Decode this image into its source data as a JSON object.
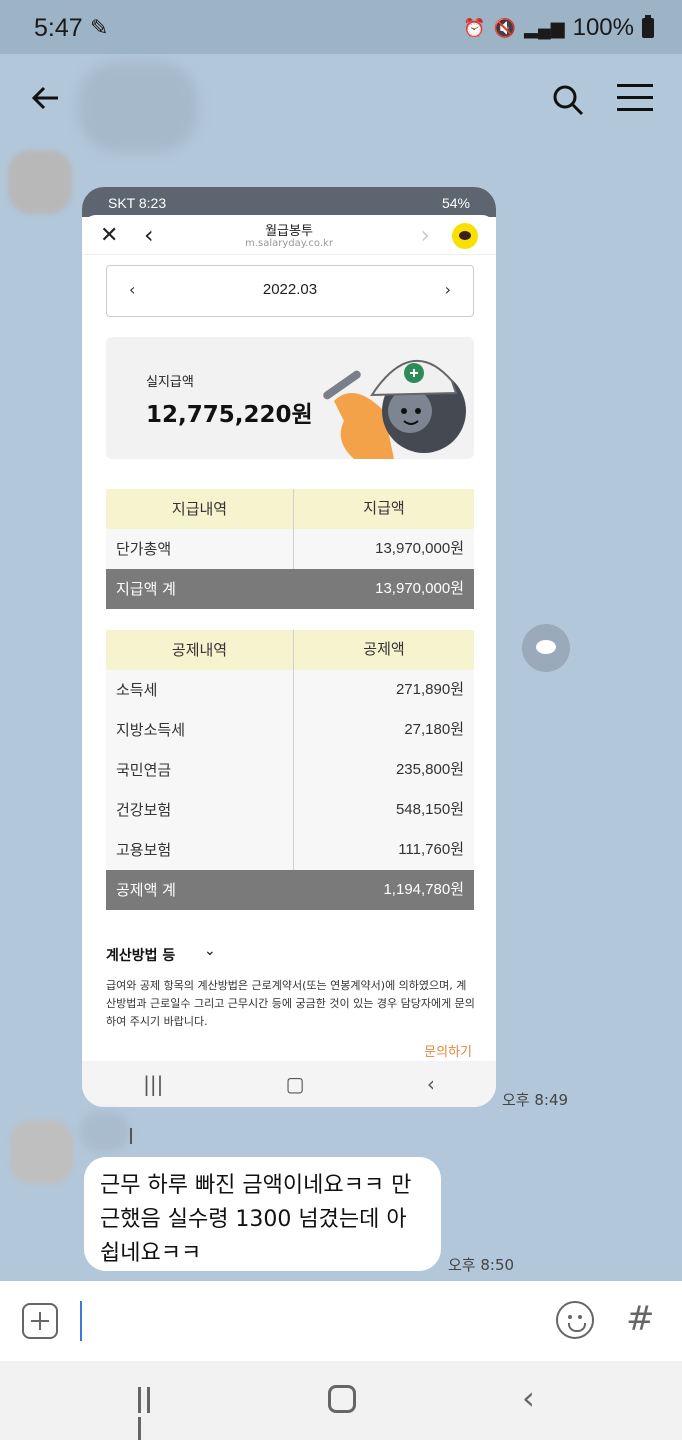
{
  "status_bar": {
    "time": "5:47",
    "battery": "100%"
  },
  "shot": {
    "status": {
      "left": "SKT 8:23",
      "right": "54%"
    },
    "browser": {
      "title": "월급봉투",
      "url": "m.salaryday.co.kr"
    },
    "month": "2022.03",
    "pay": {
      "label": "실지급액",
      "amount": "12,775,220원"
    },
    "pay_table": {
      "headers": [
        "지급내역",
        "지급액"
      ],
      "rows": [
        {
          "name": "단가총액",
          "value": "13,970,000원"
        }
      ],
      "total": {
        "name": "지급액 계",
        "value": "13,970,000원"
      }
    },
    "deduct_table": {
      "headers": [
        "공제내역",
        "공제액"
      ],
      "rows": [
        {
          "name": "소득세",
          "value": "271,890원"
        },
        {
          "name": "지방소득세",
          "value": "27,180원"
        },
        {
          "name": "국민연금",
          "value": "235,800원"
        },
        {
          "name": "건강보험",
          "value": "548,150원"
        },
        {
          "name": "고용보험",
          "value": "111,760원"
        }
      ],
      "total": {
        "name": "공제액 계",
        "value": "1,194,780원"
      }
    },
    "calc": {
      "title": "계산방법 등",
      "text": "급여와 공제 항목의 계산방법은 근로계약서(또는 연봉계약서)에 의하였으며, 계산방법과 근로일수 그리고 근무시간 등에 궁금한 것이 있는 경우 담당자에게 문의하여 주시기 바랍니다.",
      "inquiry": "문의하기"
    }
  },
  "messages": {
    "image_time": "오후 8:49",
    "text_time": "오후 8:50",
    "text": "근무 하루 빠진 금액이네요ㅋㅋ 만근했음 실수령 1300 넘겼는데 아쉽네요ㅋㅋ"
  },
  "input": {
    "placeholder": ""
  }
}
